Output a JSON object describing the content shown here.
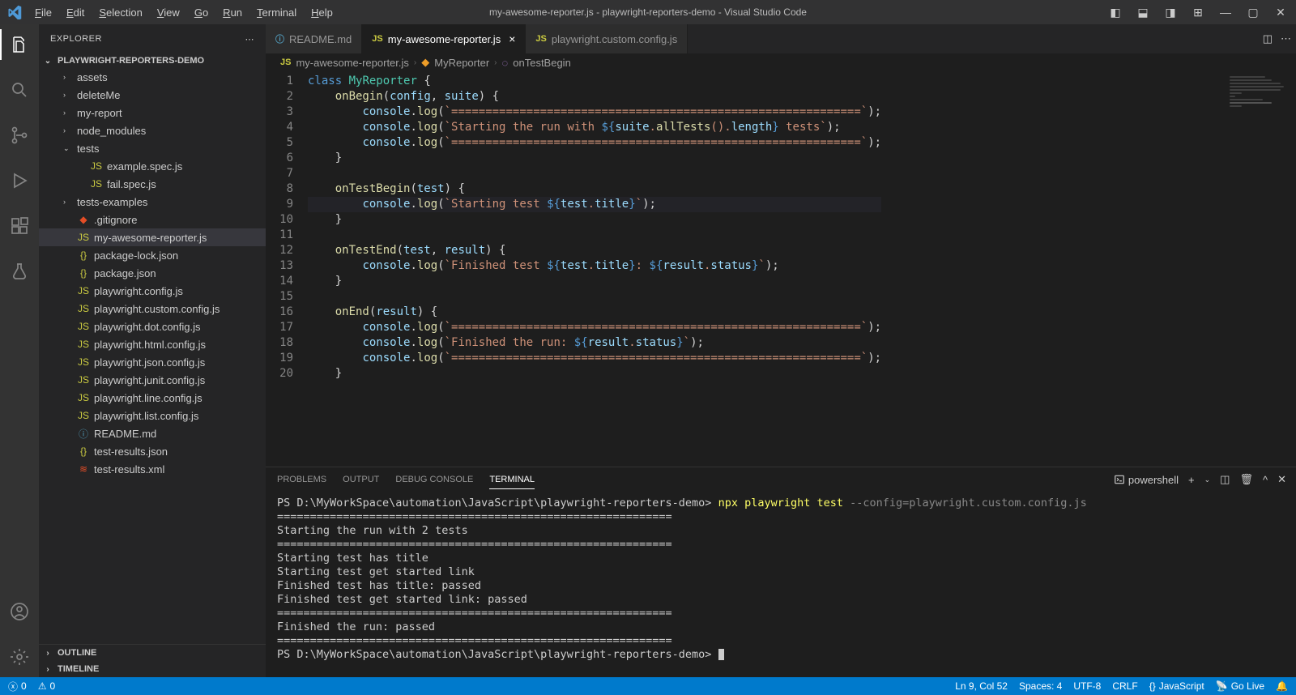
{
  "title": "my-awesome-reporter.js - playwright-reporters-demo - Visual Studio Code",
  "menus": [
    "File",
    "Edit",
    "Selection",
    "View",
    "Go",
    "Run",
    "Terminal",
    "Help"
  ],
  "sidebar": {
    "header": "EXPLORER",
    "project": "PLAYWRIGHT-REPORTERS-DEMO",
    "tree": [
      {
        "t": "folder",
        "chev": "›",
        "label": "assets",
        "indent": 1
      },
      {
        "t": "folder",
        "chev": "›",
        "label": "deleteMe",
        "indent": 1
      },
      {
        "t": "folder",
        "chev": "›",
        "label": "my-report",
        "indent": 1
      },
      {
        "t": "folder",
        "chev": "›",
        "label": "node_modules",
        "indent": 1
      },
      {
        "t": "folder",
        "chev": "⌄",
        "label": "tests",
        "indent": 1
      },
      {
        "t": "file",
        "ic": "JS",
        "cls": "ic-js",
        "label": "example.spec.js",
        "indent": 2
      },
      {
        "t": "file",
        "ic": "JS",
        "cls": "ic-js",
        "label": "fail.spec.js",
        "indent": 2
      },
      {
        "t": "folder",
        "chev": "›",
        "label": "tests-examples",
        "indent": 1
      },
      {
        "t": "file",
        "ic": "◆",
        "cls": "ic-git",
        "label": ".gitignore",
        "indent": 1
      },
      {
        "t": "file",
        "ic": "JS",
        "cls": "ic-js",
        "label": "my-awesome-reporter.js",
        "indent": 1,
        "selected": true
      },
      {
        "t": "file",
        "ic": "{}",
        "cls": "ic-json",
        "label": "package-lock.json",
        "indent": 1
      },
      {
        "t": "file",
        "ic": "{}",
        "cls": "ic-json",
        "label": "package.json",
        "indent": 1
      },
      {
        "t": "file",
        "ic": "JS",
        "cls": "ic-js",
        "label": "playwright.config.js",
        "indent": 1
      },
      {
        "t": "file",
        "ic": "JS",
        "cls": "ic-js",
        "label": "playwright.custom.config.js",
        "indent": 1
      },
      {
        "t": "file",
        "ic": "JS",
        "cls": "ic-js",
        "label": "playwright.dot.config.js",
        "indent": 1
      },
      {
        "t": "file",
        "ic": "JS",
        "cls": "ic-js",
        "label": "playwright.html.config.js",
        "indent": 1
      },
      {
        "t": "file",
        "ic": "JS",
        "cls": "ic-js",
        "label": "playwright.json.config.js",
        "indent": 1
      },
      {
        "t": "file",
        "ic": "JS",
        "cls": "ic-js",
        "label": "playwright.junit.config.js",
        "indent": 1
      },
      {
        "t": "file",
        "ic": "JS",
        "cls": "ic-js",
        "label": "playwright.line.config.js",
        "indent": 1
      },
      {
        "t": "file",
        "ic": "JS",
        "cls": "ic-js",
        "label": "playwright.list.config.js",
        "indent": 1
      },
      {
        "t": "file",
        "ic": "ⓘ",
        "cls": "ic-info",
        "label": "README.md",
        "indent": 1
      },
      {
        "t": "file",
        "ic": "{}",
        "cls": "ic-json",
        "label": "test-results.json",
        "indent": 1
      },
      {
        "t": "file",
        "ic": "≋",
        "cls": "ic-xml",
        "label": "test-results.xml",
        "indent": 1
      }
    ],
    "outline": "OUTLINE",
    "timeline": "TIMELINE"
  },
  "tabs": [
    {
      "ic": "ⓘ",
      "cls": "ic-info",
      "label": "README.md",
      "active": false,
      "close": false
    },
    {
      "ic": "JS",
      "cls": "ic-js",
      "label": "my-awesome-reporter.js",
      "active": true,
      "close": true
    },
    {
      "ic": "JS",
      "cls": "ic-js",
      "label": "playwright.custom.config.js",
      "active": false,
      "close": false
    }
  ],
  "breadcrumbs": {
    "file": "my-awesome-reporter.js",
    "class": "MyReporter",
    "method": "onTestBegin"
  },
  "code": {
    "lines": 20,
    "bar": "============================================================"
  },
  "panel": {
    "tabs": [
      "PROBLEMS",
      "OUTPUT",
      "DEBUG CONSOLE",
      "TERMINAL"
    ],
    "active": 3,
    "shell": "powershell",
    "terminal": {
      "prompt": "PS D:\\MyWorkSpace\\automation\\JavaScript\\playwright-reporters-demo>",
      "cmd": "npx playwright test",
      "flag": "--config=playwright.custom.config.js",
      "lines": [
        "============================================================",
        "Starting the run with 2 tests",
        "============================================================",
        "Starting test has title",
        "Starting test get started link",
        "Finished test has title: passed",
        "Finished test get started link: passed",
        "============================================================",
        "Finished the run: passed",
        "============================================================"
      ]
    }
  },
  "status": {
    "errors": "0",
    "warnings": "0",
    "pos": "Ln 9, Col 52",
    "spaces": "Spaces: 4",
    "enc": "UTF-8",
    "eol": "CRLF",
    "lang": "JavaScript",
    "live": "Go Live"
  }
}
